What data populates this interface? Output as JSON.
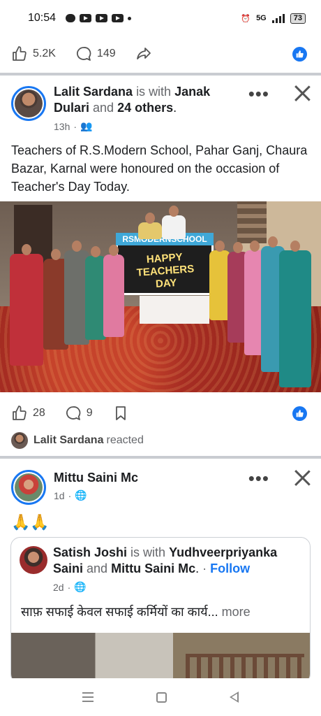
{
  "status_bar": {
    "time": "10:54",
    "battery": "73",
    "network": "5G"
  },
  "top_engagement": {
    "likes": "5.2K",
    "comments": "149"
  },
  "post1": {
    "author": "Lalit Sardana",
    "with_text": "is with",
    "tagged": "Janak Dulari",
    "and_text": "and",
    "others": "24 others",
    "time": "13h",
    "text": "Teachers of R.S.Modern School, Pahar Ganj, Chaura Bazar, Karnal were honoured on the occasion of Teacher's Day Today.",
    "banner_top": "RSMODERNSCHOOL",
    "banner_title": "HAPPY TEACHERS DAY",
    "likes": "28",
    "comments": "9",
    "reacted_name": "Lalit Sardana",
    "reacted_text": "reacted"
  },
  "post2": {
    "author": "Mittu Saini Mc",
    "time": "1d",
    "emoji": "🙏🙏",
    "shared": {
      "author": "Satish Joshi",
      "with_text": "is with",
      "tagged": "Yudhveerpriyanka Saini",
      "and_text": "and",
      "tagged2": "Mittu Saini Mc",
      "follow": "Follow",
      "time": "2d",
      "text": "साफ़ सफाई केवल सफाई कर्मियों का कार्य...",
      "more": "more"
    }
  },
  "colors": {
    "accent": "#1877f2",
    "divider": "#c9ccd1"
  }
}
